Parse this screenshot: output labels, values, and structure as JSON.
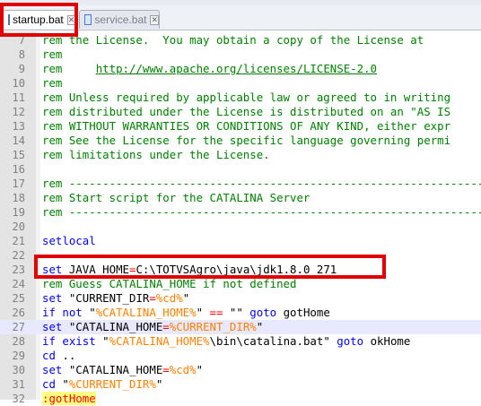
{
  "tabs": [
    {
      "label": "startup.bat",
      "active": true
    },
    {
      "label": "service.bat",
      "active": false
    }
  ],
  "lines": [
    {
      "n": "7",
      "segs": [
        {
          "t": "rem the License.  You may obtain a copy of the License at",
          "c": "com"
        }
      ]
    },
    {
      "n": "8",
      "segs": [
        {
          "t": "rem",
          "c": "com"
        }
      ]
    },
    {
      "n": "9",
      "segs": [
        {
          "t": "rem     ",
          "c": "com"
        },
        {
          "t": "http://www.apache.org/licenses/LICENSE-2.0",
          "c": "url"
        }
      ]
    },
    {
      "n": "10",
      "segs": [
        {
          "t": "rem",
          "c": "com"
        }
      ]
    },
    {
      "n": "11",
      "segs": [
        {
          "t": "rem Unless required by applicable law or agreed to in writing",
          "c": "com"
        }
      ]
    },
    {
      "n": "12",
      "segs": [
        {
          "t": "rem distributed under the License is distributed on an \"AS IS",
          "c": "com"
        }
      ]
    },
    {
      "n": "13",
      "segs": [
        {
          "t": "rem WITHOUT WARRANTIES OR CONDITIONS OF ANY KIND, either expr",
          "c": "com"
        }
      ]
    },
    {
      "n": "14",
      "segs": [
        {
          "t": "rem See the License for the specific language governing permi",
          "c": "com"
        }
      ]
    },
    {
      "n": "15",
      "segs": [
        {
          "t": "rem limitations under the License.",
          "c": "com"
        }
      ]
    },
    {
      "n": "16",
      "segs": []
    },
    {
      "n": "17",
      "segs": [
        {
          "t": "rem ---------------------------------------------------------------",
          "c": "com"
        }
      ]
    },
    {
      "n": "18",
      "segs": [
        {
          "t": "rem Start script for the CATALINA Server",
          "c": "com"
        }
      ]
    },
    {
      "n": "19",
      "segs": [
        {
          "t": "rem ---------------------------------------------------------------",
          "c": "com"
        }
      ]
    },
    {
      "n": "20",
      "segs": []
    },
    {
      "n": "21",
      "segs": [
        {
          "t": "setlocal",
          "c": "kw"
        }
      ]
    },
    {
      "n": "22",
      "segs": []
    },
    {
      "n": "23",
      "segs": [
        {
          "t": "set",
          "c": "kw"
        },
        {
          "t": " JAVA_HOME",
          "c": "plain"
        },
        {
          "t": "=",
          "c": "op"
        },
        {
          "t": "C:\\TOTVSAgro\\java\\jdk1.8.0_271",
          "c": "plain"
        }
      ]
    },
    {
      "n": "24",
      "segs": [
        {
          "t": "rem Guess CATALINA_HOME if not defined",
          "c": "com"
        }
      ]
    },
    {
      "n": "25",
      "segs": [
        {
          "t": "set",
          "c": "kw"
        },
        {
          "t": " \"CURRENT_DIR",
          "c": "plain"
        },
        {
          "t": "=",
          "c": "op"
        },
        {
          "t": "%cd%",
          "c": "var"
        },
        {
          "t": "\"",
          "c": "plain"
        }
      ]
    },
    {
      "n": "26",
      "segs": [
        {
          "t": "if not",
          "c": "kw"
        },
        {
          "t": " \"",
          "c": "plain"
        },
        {
          "t": "%CATALINA_HOME%",
          "c": "var"
        },
        {
          "t": "\" ",
          "c": "plain"
        },
        {
          "t": "==",
          "c": "op"
        },
        {
          "t": " \"\" ",
          "c": "plain"
        },
        {
          "t": "goto",
          "c": "kw"
        },
        {
          "t": " gotHome",
          "c": "plain"
        }
      ]
    },
    {
      "n": "27",
      "segs": [
        {
          "t": "set",
          "c": "kw"
        },
        {
          "t": " \"CATALINA_HOME",
          "c": "plain"
        },
        {
          "t": "=",
          "c": "op"
        },
        {
          "t": "%CURRENT_DIR%",
          "c": "var"
        },
        {
          "t": "\"",
          "c": "plain"
        }
      ],
      "current": true
    },
    {
      "n": "28",
      "segs": [
        {
          "t": "if exist",
          "c": "kw"
        },
        {
          "t": " \"",
          "c": "plain"
        },
        {
          "t": "%CATALINA_HOME%",
          "c": "var"
        },
        {
          "t": "\\bin\\catalina.bat\" ",
          "c": "plain"
        },
        {
          "t": "goto",
          "c": "kw"
        },
        {
          "t": " okHome",
          "c": "plain"
        }
      ]
    },
    {
      "n": "29",
      "segs": [
        {
          "t": "cd",
          "c": "kw"
        },
        {
          "t": " ..",
          "c": "plain"
        }
      ]
    },
    {
      "n": "30",
      "segs": [
        {
          "t": "set",
          "c": "kw"
        },
        {
          "t": " \"CATALINA_HOME",
          "c": "plain"
        },
        {
          "t": "=",
          "c": "op"
        },
        {
          "t": "%cd%",
          "c": "var"
        },
        {
          "t": "\"",
          "c": "plain"
        }
      ]
    },
    {
      "n": "31",
      "segs": [
        {
          "t": "cd",
          "c": "kw"
        },
        {
          "t": " \"",
          "c": "plain"
        },
        {
          "t": "%CURRENT_DIR%",
          "c": "var"
        },
        {
          "t": "\"",
          "c": "plain"
        }
      ]
    },
    {
      "n": "32",
      "segs": [
        {
          "t": ":gotHome",
          "c": "lbl"
        }
      ]
    }
  ]
}
